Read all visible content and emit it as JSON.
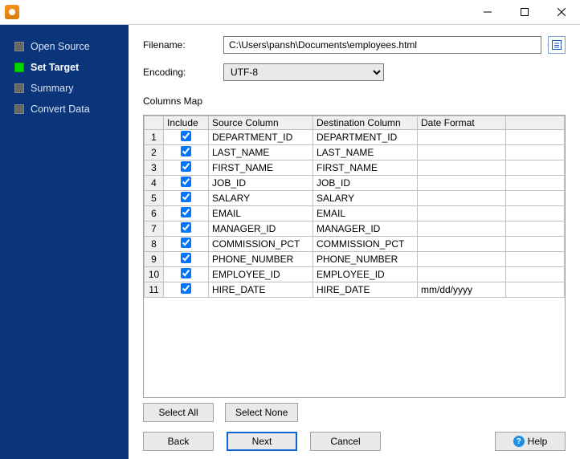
{
  "sidebar": {
    "items": [
      {
        "label": "Open Source",
        "active": false
      },
      {
        "label": "Set Target",
        "active": true
      },
      {
        "label": "Summary",
        "active": false
      },
      {
        "label": "Convert Data",
        "active": false
      }
    ]
  },
  "filename": {
    "label": "Filename:",
    "value": "C:\\Users\\pansh\\Documents\\employees.html"
  },
  "encoding": {
    "label": "Encoding:",
    "value": "UTF-8",
    "options": [
      "UTF-8"
    ]
  },
  "columns_map": {
    "label": "Columns Map",
    "headers": {
      "include": "Include",
      "source": "Source Column",
      "destination": "Destination Column",
      "date_format": "Date Format"
    },
    "rows": [
      {
        "n": 1,
        "include": true,
        "source": "DEPARTMENT_ID",
        "destination": "DEPARTMENT_ID",
        "date_format": ""
      },
      {
        "n": 2,
        "include": true,
        "source": "LAST_NAME",
        "destination": "LAST_NAME",
        "date_format": ""
      },
      {
        "n": 3,
        "include": true,
        "source": "FIRST_NAME",
        "destination": "FIRST_NAME",
        "date_format": ""
      },
      {
        "n": 4,
        "include": true,
        "source": "JOB_ID",
        "destination": "JOB_ID",
        "date_format": ""
      },
      {
        "n": 5,
        "include": true,
        "source": "SALARY",
        "destination": "SALARY",
        "date_format": ""
      },
      {
        "n": 6,
        "include": true,
        "source": "EMAIL",
        "destination": "EMAIL",
        "date_format": ""
      },
      {
        "n": 7,
        "include": true,
        "source": "MANAGER_ID",
        "destination": "MANAGER_ID",
        "date_format": ""
      },
      {
        "n": 8,
        "include": true,
        "source": "COMMISSION_PCT",
        "destination": "COMMISSION_PCT",
        "date_format": ""
      },
      {
        "n": 9,
        "include": true,
        "source": "PHONE_NUMBER",
        "destination": "PHONE_NUMBER",
        "date_format": ""
      },
      {
        "n": 10,
        "include": true,
        "source": "EMPLOYEE_ID",
        "destination": "EMPLOYEE_ID",
        "date_format": ""
      },
      {
        "n": 11,
        "include": true,
        "source": "HIRE_DATE",
        "destination": "HIRE_DATE",
        "date_format": "mm/dd/yyyy"
      }
    ]
  },
  "buttons": {
    "select_all": "Select All",
    "select_none": "Select None",
    "back": "Back",
    "next": "Next",
    "cancel": "Cancel",
    "help": "Help"
  }
}
